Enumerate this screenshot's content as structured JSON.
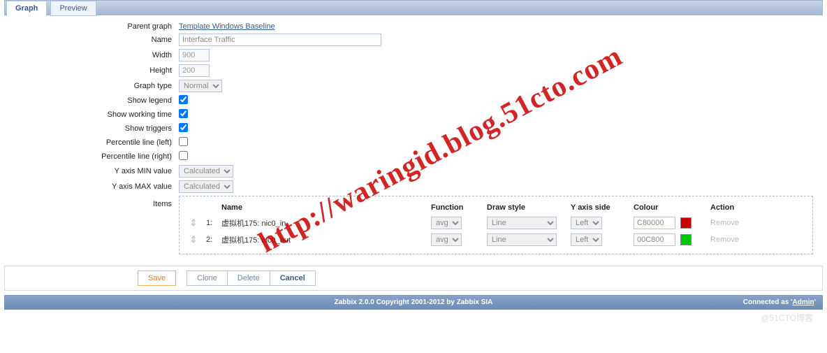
{
  "tabs": {
    "graph": "Graph",
    "preview": "Preview"
  },
  "form": {
    "parent_graph_label": "Parent graph",
    "parent_graph_link": "Template Windows Baseline",
    "name_label": "Name",
    "name_value": "Interface Traffic",
    "width_label": "Width",
    "width_value": "900",
    "height_label": "Height",
    "height_value": "200",
    "graph_type_label": "Graph type",
    "graph_type_value": "Normal",
    "show_legend_label": "Show legend",
    "show_legend_checked": true,
    "show_working_time_label": "Show working time",
    "show_working_time_checked": true,
    "show_triggers_label": "Show triggers",
    "show_triggers_checked": true,
    "percentile_left_label": "Percentile line (left)",
    "percentile_left_checked": false,
    "percentile_right_label": "Percentile line (right)",
    "percentile_right_checked": false,
    "ymin_label": "Y axis MIN value",
    "ymin_value": "Calculated",
    "ymax_label": "Y axis MAX value",
    "ymax_value": "Calculated",
    "items_label": "Items"
  },
  "items_table": {
    "headers": {
      "name": "Name",
      "function": "Function",
      "draw_style": "Draw style",
      "yaxis_side": "Y axis side",
      "colour": "Colour",
      "action": "Action"
    },
    "rows": [
      {
        "index": "1:",
        "name": "虚拟机175: nic0_in",
        "function": "avg",
        "draw_style": "Line",
        "yaxis_side": "Left",
        "colour": "C80000",
        "swatch": "#C80000",
        "action": "Remove"
      },
      {
        "index": "2:",
        "name": "虚拟机175: nic0_out",
        "function": "avg",
        "draw_style": "Line",
        "yaxis_side": "Left",
        "colour": "00C800",
        "swatch": "#00C800",
        "action": "Remove"
      }
    ]
  },
  "buttons": {
    "save": "Save",
    "clone": "Clone",
    "delete": "Delete",
    "cancel": "Cancel"
  },
  "footer": {
    "copyright": "Zabbix 2.0.0 Copyright 2001-2012 by Zabbix SIA",
    "connected_prefix": "Connected as '",
    "connected_user": "Admin",
    "connected_suffix": "'"
  },
  "watermark": "http://waringid.blog.51cto.com",
  "corner_mark": "@51CTO博客"
}
